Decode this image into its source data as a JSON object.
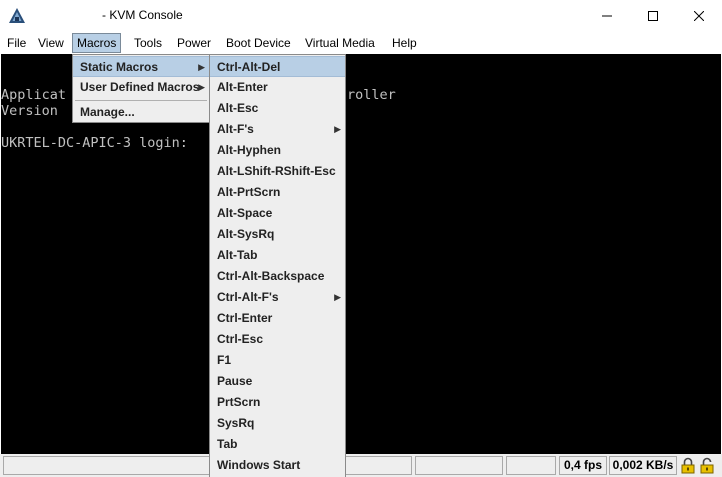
{
  "window": {
    "title": "- KVM Console",
    "controls": {
      "minimize": "─",
      "maximize": "☐",
      "close": "✕"
    }
  },
  "menubar": {
    "items": [
      {
        "label": "File"
      },
      {
        "label": "View"
      },
      {
        "label": "Macros"
      },
      {
        "label": "Tools"
      },
      {
        "label": "Power"
      },
      {
        "label": "Boot Device"
      },
      {
        "label": "Virtual Media"
      },
      {
        "label": "Help"
      }
    ]
  },
  "console": {
    "lines": [
      "Applicat",
      "Version",
      "UKRTEL-DC-APIC-3 login:"
    ],
    "right_text": "roller"
  },
  "macros_menu": {
    "items": [
      {
        "label": "Static Macros",
        "submenu": true
      },
      {
        "label": "User Defined Macros",
        "submenu": true
      },
      {
        "label": "Manage...",
        "submenu": false
      }
    ]
  },
  "static_macros_menu": {
    "items": [
      {
        "label": "Ctrl-Alt-Del"
      },
      {
        "label": "Alt-Enter"
      },
      {
        "label": "Alt-Esc"
      },
      {
        "label": "Alt-F's",
        "submenu": true
      },
      {
        "label": "Alt-Hyphen"
      },
      {
        "label": "Alt-LShift-RShift-Esc"
      },
      {
        "label": "Alt-PrtScrn"
      },
      {
        "label": "Alt-Space"
      },
      {
        "label": "Alt-SysRq"
      },
      {
        "label": "Alt-Tab"
      },
      {
        "label": "Ctrl-Alt-Backspace"
      },
      {
        "label": "Ctrl-Alt-F's",
        "submenu": true
      },
      {
        "label": "Ctrl-Enter"
      },
      {
        "label": "Ctrl-Esc"
      },
      {
        "label": "F1"
      },
      {
        "label": "Pause"
      },
      {
        "label": "PrtScrn"
      },
      {
        "label": "SysRq"
      },
      {
        "label": "Tab"
      },
      {
        "label": "Windows Start"
      }
    ]
  },
  "statusbar": {
    "fps": "0,4 fps",
    "bandwidth": "0,002 KB/s"
  },
  "colors": {
    "menu_highlight": "#b8cfe5",
    "console_bg": "#000000",
    "console_text": "#c0c0c0",
    "lock_yellow": "#e8c000"
  }
}
